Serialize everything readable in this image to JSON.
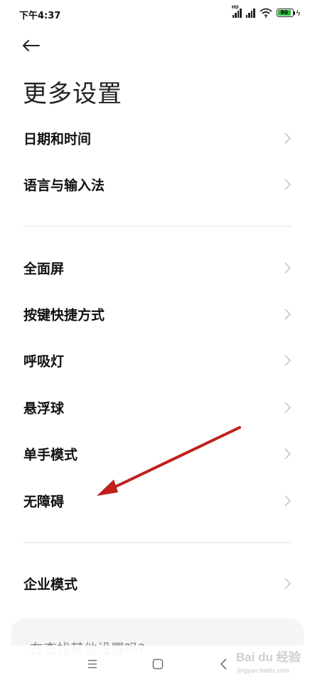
{
  "status_bar": {
    "time": "下午4:37",
    "hd_label": "HD",
    "battery_level": "90",
    "battery_percent": 90,
    "battery_color": "#2db83d"
  },
  "header": {
    "back_icon": "arrow-left-icon",
    "title": "更多设置"
  },
  "sections": [
    {
      "items": [
        {
          "label": "日期和时间"
        },
        {
          "label": "语言与输入法"
        }
      ]
    },
    {
      "items": [
        {
          "label": "全面屏"
        },
        {
          "label": "按键快捷方式"
        },
        {
          "label": "呼吸灯"
        },
        {
          "label": "悬浮球"
        },
        {
          "label": "单手模式"
        },
        {
          "label": "无障碍"
        }
      ]
    },
    {
      "items": [
        {
          "label": "企业模式"
        }
      ]
    }
  ],
  "suggestion": {
    "text": "在查找其他设置吗?"
  },
  "nav_bar": {
    "menu_icon": "menu-icon",
    "home_icon": "home-square-icon",
    "back_icon": "back-triangle-icon"
  },
  "watermark": {
    "logo": "Bai du 经验",
    "url": "jingyan.baidu.com"
  },
  "annotation": {
    "color": "#c0201c"
  }
}
